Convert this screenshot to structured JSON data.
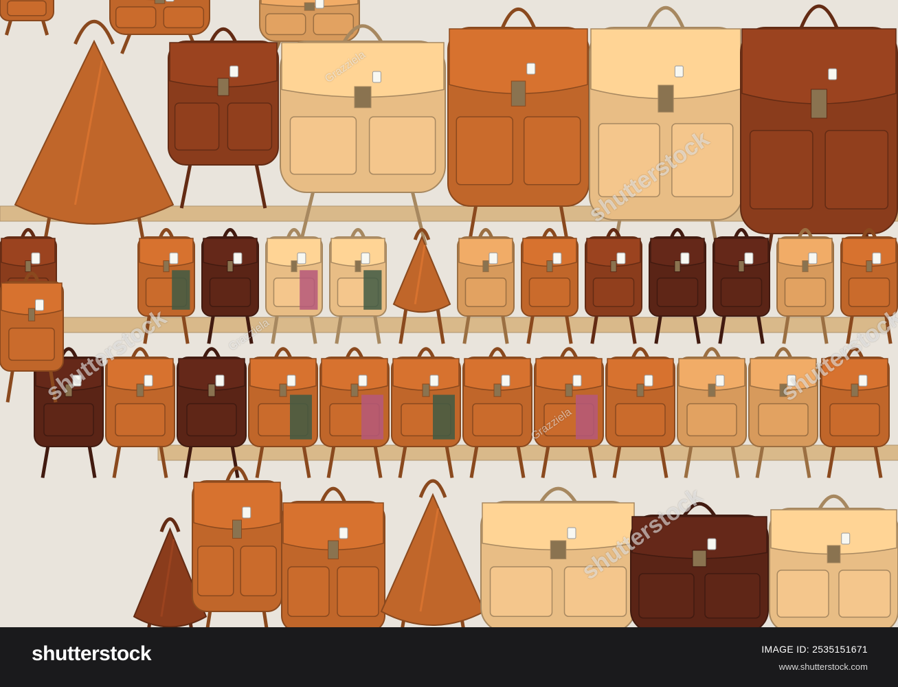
{
  "photo": {
    "subject": "leather-backpacks-on-wall",
    "colors": {
      "wall": "#e9e4dc",
      "rail": "#d9b98a",
      "tan": "#d79a5c",
      "light": "#e8bd85",
      "cognac": "#c0662a",
      "brown": "#8a3c1c",
      "dark": "#5a2416"
    },
    "watermarks": {
      "brand": "shutterstock",
      "author": "Grazziela"
    }
  },
  "footer": {
    "logo": "shutterstock",
    "image_id": "IMAGE ID: 2535151671",
    "url": "www.shutterstock.com"
  }
}
